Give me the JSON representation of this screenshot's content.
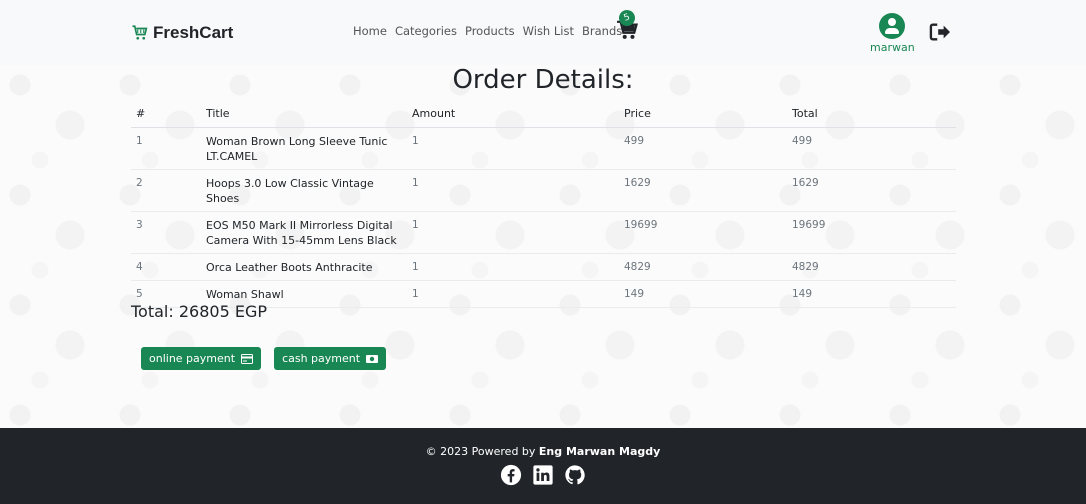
{
  "brand": {
    "name": "FreshCart",
    "color": "#198754"
  },
  "nav": {
    "links": [
      "Home",
      "Categories",
      "Products",
      "Wish List",
      "Brands"
    ],
    "cart_count": "5",
    "username": "marwan"
  },
  "page": {
    "title": "Order Details:"
  },
  "table": {
    "headers": [
      "#",
      "Title",
      "Amount",
      "Price",
      "Total"
    ],
    "rows": [
      {
        "idx": "1",
        "title": "Woman Brown Long Sleeve Tunic LT.CAMEL",
        "amount": "1",
        "price": "499",
        "total": "499"
      },
      {
        "idx": "2",
        "title": "Hoops 3.0 Low Classic Vintage Shoes",
        "amount": "1",
        "price": "1629",
        "total": "1629"
      },
      {
        "idx": "3",
        "title": "EOS M50 Mark II Mirrorless Digital Camera With 15-45mm Lens Black",
        "amount": "1",
        "price": "19699",
        "total": "19699"
      },
      {
        "idx": "4",
        "title": "Orca Leather Boots Anthracite",
        "amount": "1",
        "price": "4829",
        "total": "4829"
      },
      {
        "idx": "5",
        "title": "Woman Shawl",
        "amount": "1",
        "price": "149",
        "total": "149"
      }
    ]
  },
  "summary": {
    "total_text": "Total: 26805 EGP"
  },
  "payment": {
    "online_label": "online payment",
    "cash_label": "cash payment"
  },
  "footer": {
    "prefix": "© 2023 Powered by",
    "author": "Eng Marwan Magdy"
  },
  "icons": {
    "brand": "cart-icon",
    "cart": "cart-icon",
    "user": "user-circle-icon",
    "logout": "logout-icon",
    "online": "credit-card-icon",
    "cash": "money-bill-icon",
    "socials": [
      "facebook-icon",
      "linkedin-icon",
      "github-icon"
    ]
  }
}
